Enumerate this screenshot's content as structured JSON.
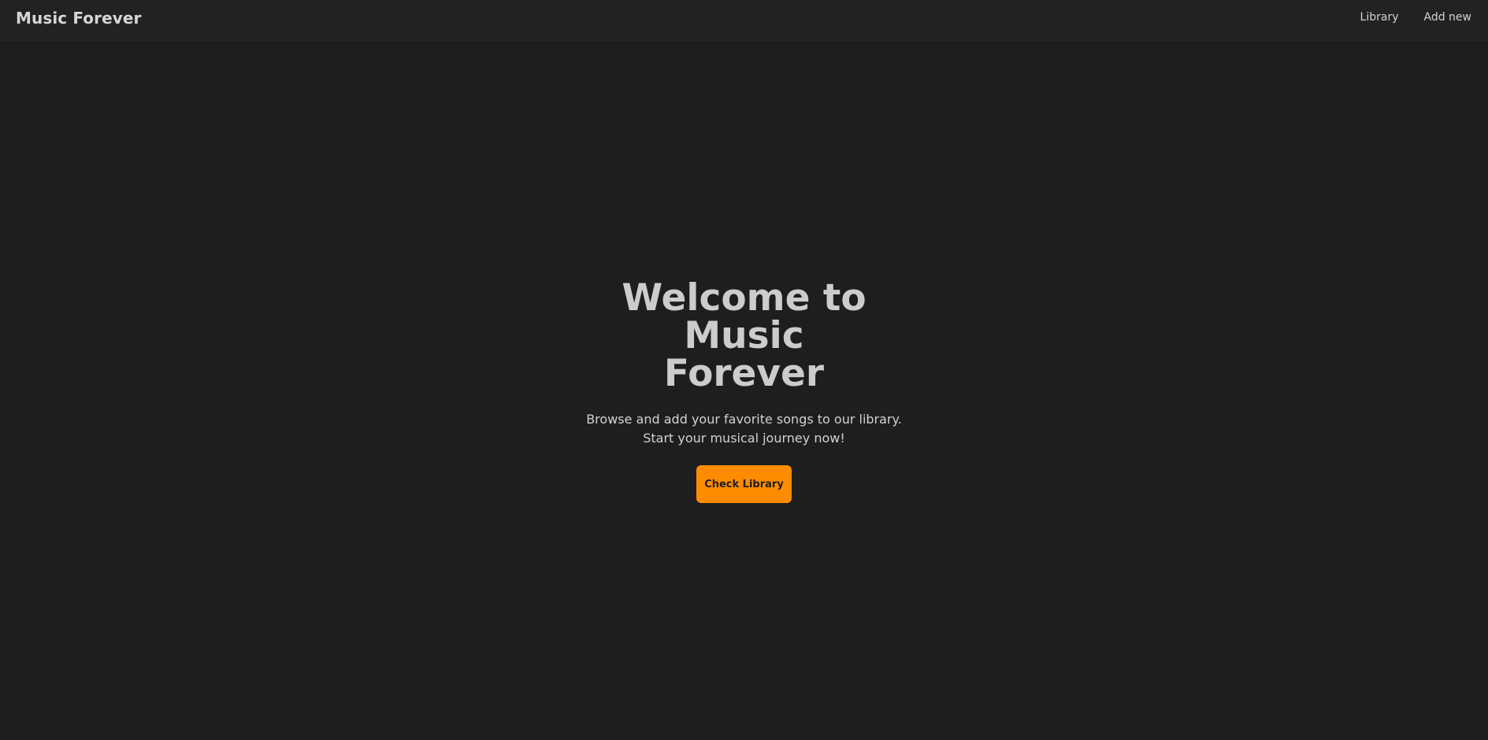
{
  "navbar": {
    "brand": "Music Forever",
    "links": [
      "Library",
      "Add new"
    ]
  },
  "hero": {
    "title": "Welcome to Music Forever",
    "subtitle": "Browse and add your favorite songs to our library. Start your musical journey now!",
    "cta_label": "Check Library"
  },
  "colors": {
    "background": "#1e1e1e",
    "navbar": "#222222",
    "accent": "#ff8c00",
    "text": "#cfcfcf"
  }
}
